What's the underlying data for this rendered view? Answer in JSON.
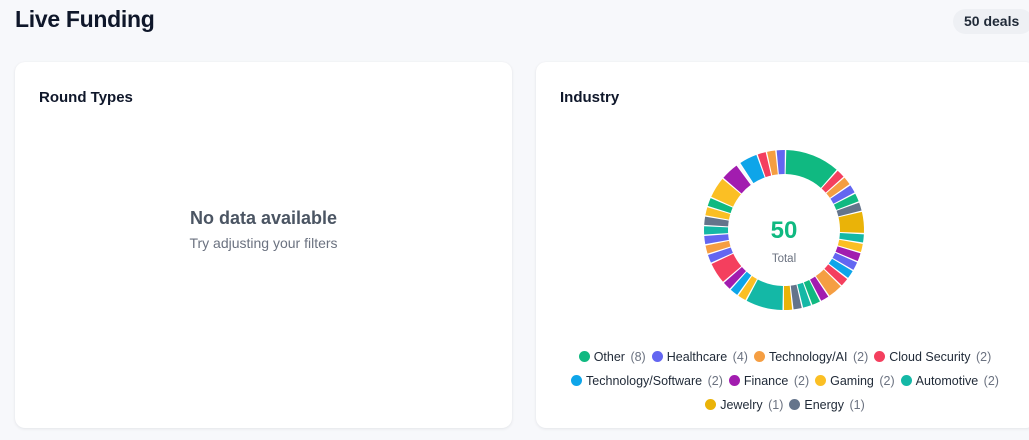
{
  "header": {
    "title": "Live Funding",
    "deals_badge": "50 deals"
  },
  "round_types": {
    "title": "Round Types",
    "empty_title": "No data available",
    "empty_subtitle": "Try adjusting your filters"
  },
  "industry": {
    "title": "Industry",
    "total_value": "50",
    "total_label": "Total",
    "legend": [
      {
        "label": "Other",
        "count": "(8)",
        "color": "#10b981"
      },
      {
        "label": "Healthcare",
        "count": "(4)",
        "color": "#6366f1"
      },
      {
        "label": "Technology/AI",
        "count": "(2)",
        "color": "#f59e42"
      },
      {
        "label": "Cloud Security",
        "count": "(2)",
        "color": "#f43f5e"
      },
      {
        "label": "Technology/Software",
        "count": "(2)",
        "color": "#0ea5e9"
      },
      {
        "label": "Finance",
        "count": "(2)",
        "color": "#a21caf"
      },
      {
        "label": "Gaming",
        "count": "(2)",
        "color": "#fbbf24"
      },
      {
        "label": "Automotive",
        "count": "(2)",
        "color": "#14b8a6"
      },
      {
        "label": "Jewelry",
        "count": "(1)",
        "color": "#eab308"
      },
      {
        "label": "Energy",
        "count": "(1)",
        "color": "#64748b"
      }
    ]
  },
  "chart_data": {
    "type": "pie",
    "title": "Industry",
    "total": 50,
    "slices": [
      {
        "name": "Other",
        "value": 8
      },
      {
        "name": "Healthcare",
        "value": 4
      },
      {
        "name": "Technology/AI",
        "value": 2
      },
      {
        "name": "Cloud Security",
        "value": 2
      },
      {
        "name": "Technology/Software",
        "value": 2
      },
      {
        "name": "Finance",
        "value": 2
      },
      {
        "name": "Gaming",
        "value": 2
      },
      {
        "name": "Automotive",
        "value": 2
      },
      {
        "name": "Jewelry",
        "value": 1
      },
      {
        "name": "Energy",
        "value": 1
      }
    ],
    "ring_sequence": [
      {
        "c": "#10b981",
        "v": 3.5
      },
      {
        "c": "#f43f5e",
        "v": 0.6
      },
      {
        "c": "#f59e42",
        "v": 0.6
      },
      {
        "c": "#6366f1",
        "v": 0.6
      },
      {
        "c": "#10b981",
        "v": 0.6
      },
      {
        "c": "#64748b",
        "v": 0.6
      },
      {
        "c": "#eab308",
        "v": 1.4
      },
      {
        "c": "#14b8a6",
        "v": 0.6
      },
      {
        "c": "#fbbf24",
        "v": 0.6
      },
      {
        "c": "#a21caf",
        "v": 0.6
      },
      {
        "c": "#6366f1",
        "v": 0.6
      },
      {
        "c": "#0ea5e9",
        "v": 0.6
      },
      {
        "c": "#f43f5e",
        "v": 0.6
      },
      {
        "c": "#f59e42",
        "v": 1.0
      },
      {
        "c": "#a21caf",
        "v": 0.6
      },
      {
        "c": "#10b981",
        "v": 0.6
      },
      {
        "c": "#14b8a6",
        "v": 0.6
      },
      {
        "c": "#64748b",
        "v": 0.6
      },
      {
        "c": "#eab308",
        "v": 0.6
      },
      {
        "c": "#14b8a6",
        "v": 2.4
      },
      {
        "c": "#fbbf24",
        "v": 0.6
      },
      {
        "c": "#0ea5e9",
        "v": 0.6
      },
      {
        "c": "#a21caf",
        "v": 0.6
      },
      {
        "c": "#f43f5e",
        "v": 1.4
      },
      {
        "c": "#6366f1",
        "v": 0.6
      },
      {
        "c": "#f59e42",
        "v": 0.6
      },
      {
        "c": "#6366f1",
        "v": 0.6
      },
      {
        "c": "#14b8a6",
        "v": 0.6
      },
      {
        "c": "#64748b",
        "v": 0.6
      },
      {
        "c": "#fbbf24",
        "v": 0.6
      },
      {
        "c": "#10b981",
        "v": 0.6
      },
      {
        "c": "#fbbf24",
        "v": 1.4
      },
      {
        "c": "#a21caf",
        "v": 1.2
      },
      {
        "c": "#f8fafc",
        "v": 0.2
      },
      {
        "c": "#0ea5e9",
        "v": 1.2
      },
      {
        "c": "#f43f5e",
        "v": 0.6
      },
      {
        "c": "#f59e42",
        "v": 0.6
      },
      {
        "c": "#6366f1",
        "v": 0.6
      }
    ]
  }
}
